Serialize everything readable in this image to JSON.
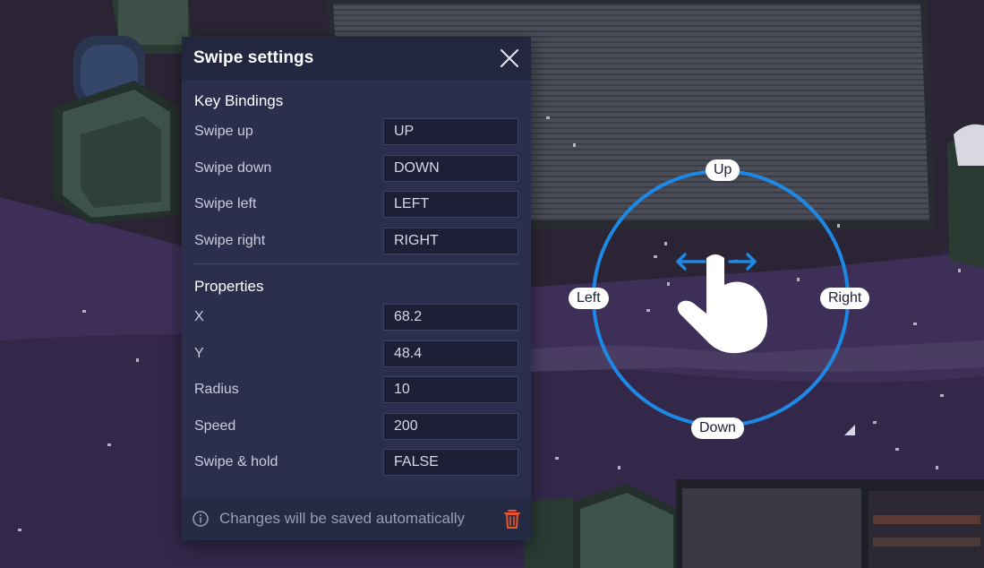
{
  "panel": {
    "title": "Swipe settings",
    "key_bindings": {
      "title": "Key Bindings",
      "rows": [
        {
          "label": "Swipe up",
          "value": "UP"
        },
        {
          "label": "Swipe down",
          "value": "DOWN"
        },
        {
          "label": "Swipe left",
          "value": "LEFT"
        },
        {
          "label": "Swipe right",
          "value": "RIGHT"
        }
      ]
    },
    "properties": {
      "title": "Properties",
      "rows": [
        {
          "label": "X",
          "value": "68.2"
        },
        {
          "label": "Y",
          "value": "48.4"
        },
        {
          "label": "Radius",
          "value": "10"
        },
        {
          "label": "Speed",
          "value": "200"
        },
        {
          "label": "Swipe & hold",
          "value": "FALSE"
        }
      ]
    },
    "footer_text": "Changes will be saved automatically"
  },
  "widget": {
    "labels": {
      "up": "Up",
      "down": "Down",
      "left": "Left",
      "right": "Right"
    }
  },
  "colors": {
    "accent": "#1e88e5",
    "delete": "#e8572a",
    "panel_bg": "#2b2f4d",
    "header_bg": "#22263e"
  },
  "icons": {
    "close": "close-icon",
    "info": "info-icon",
    "delete": "trash-icon",
    "gesture": "swipe-hand-icon"
  }
}
